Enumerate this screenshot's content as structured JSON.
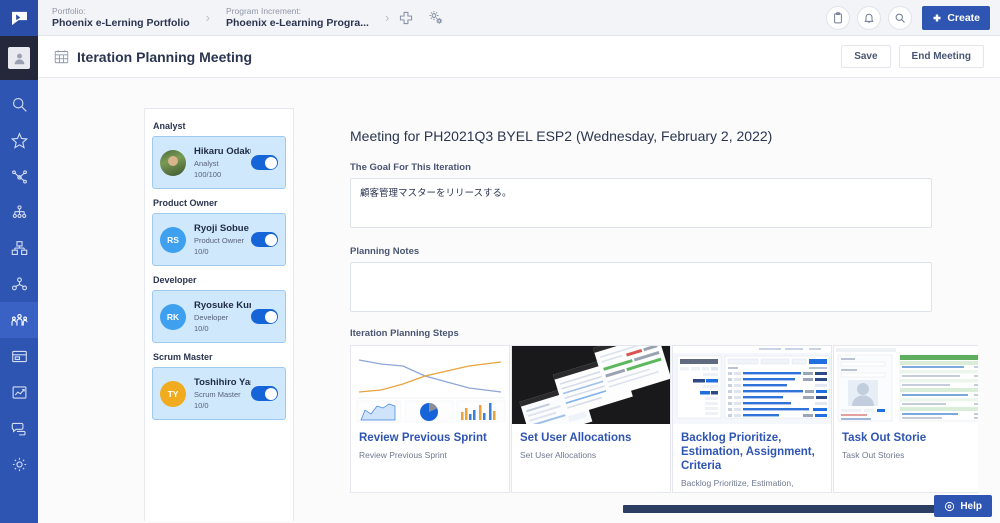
{
  "topbar": {
    "logo_icon": "app-logo-icon",
    "breadcrumbs": [
      {
        "label": "Portfolio:",
        "value": "Phoenix e-Lerning Portfolio"
      },
      {
        "label": "Program Increment:",
        "value": "Phoenix e-Learning Progra..."
      }
    ],
    "separator": "›",
    "add_icon": "plus-icon",
    "settings_icon": "gears-icon",
    "clipboard_icon": "clipboard-icon",
    "bell_icon": "bell-icon",
    "search_icon": "search-icon",
    "create_label": "Create",
    "create_icon": "plus-icon"
  },
  "left_rail": {
    "avatar_icon": "user-avatar-icon",
    "items": [
      {
        "name": "search",
        "icon": "search-icon",
        "active": false
      },
      {
        "name": "favorites",
        "icon": "star-icon",
        "active": false
      },
      {
        "name": "strategy",
        "icon": "network-nodes-icon",
        "active": false
      },
      {
        "name": "portfolio",
        "icon": "hierarchy-icon",
        "active": false
      },
      {
        "name": "program",
        "icon": "org-chart-icon",
        "active": false
      },
      {
        "name": "teams",
        "icon": "people-group-icon",
        "active": false
      },
      {
        "name": "meetings",
        "icon": "team-meeting-icon",
        "active": true
      },
      {
        "name": "boards",
        "icon": "board-icon",
        "active": false
      },
      {
        "name": "reports",
        "icon": "chart-up-icon",
        "active": false
      },
      {
        "name": "chat",
        "icon": "chat-bubbles-icon",
        "active": false
      },
      {
        "name": "settings",
        "icon": "gear-icon",
        "active": false
      }
    ]
  },
  "page_header": {
    "icon": "calendar-grid-icon",
    "title": "Iteration Planning Meeting",
    "save_label": "Save",
    "end_meeting_label": "End Meeting"
  },
  "participants": {
    "groups": [
      {
        "role_label": "Analyst",
        "member": {
          "name": "Hikaru Odakura",
          "role": "Analyst",
          "count": "100/100",
          "avatar_type": "photo",
          "initials": "",
          "avatar_color": "#6c8f4c",
          "toggle_on": true
        }
      },
      {
        "role_label": "Product Owner",
        "member": {
          "name": "Ryoji Sobue",
          "role": "Product Owner",
          "count": "10/0",
          "avatar_type": "initials",
          "initials": "RS",
          "avatar_color": "#3fa0ef",
          "toggle_on": true
        }
      },
      {
        "role_label": "Developer",
        "member": {
          "name": "Ryosuke Kumai",
          "role": "Developer",
          "count": "10/0",
          "avatar_type": "initials",
          "initials": "RK",
          "avatar_color": "#3fa0ef",
          "toggle_on": true
        }
      },
      {
        "role_label": "Scrum Master",
        "member": {
          "name": "Toshihiro Yam...",
          "role": "Scrum Master",
          "count": "10/0",
          "avatar_type": "initials",
          "initials": "TY",
          "avatar_color": "#f0ab1e",
          "toggle_on": true
        }
      }
    ]
  },
  "detail": {
    "meeting_title": "Meeting for PH2021Q3 BYEL ESP2 (Wednesday, February 2, 2022)",
    "goal_label": "The Goal For This Iteration",
    "goal_value": "顧客管理マスターをリリースする。",
    "notes_label": "Planning Notes",
    "notes_value": "",
    "steps_label": "Iteration Planning Steps",
    "steps": [
      {
        "title": "Review Previous Sprint",
        "subtitle": "Review Previous Sprint",
        "thumb": "charts-dashboard"
      },
      {
        "title": "Set User Allocations",
        "subtitle": "Set User Allocations",
        "thumb": "dark-screens"
      },
      {
        "title": "Backlog Prioritize, Estimation, Assignment, Criteria",
        "subtitle": "Backlog Prioritize, Estimation,",
        "thumb": "backlog-table"
      },
      {
        "title": "Task Out Storie",
        "subtitle": "Task Out Stories",
        "thumb": "spreadsheet-profile"
      }
    ]
  },
  "help": {
    "label": "Help",
    "icon": "help-circle-icon"
  },
  "colors": {
    "brand_blue": "#2f55b3",
    "rail_blue": "#2f55b3",
    "rail_active": "#3a62c4",
    "card_blue_bg": "#cfe8fb",
    "card_blue_border": "#9fc9ee",
    "toggle_on": "#1565d8",
    "link_blue": "#2f55b3",
    "text_dark": "#2b3550",
    "text_muted": "#70798f",
    "scrollbar": "#2d3e63"
  }
}
